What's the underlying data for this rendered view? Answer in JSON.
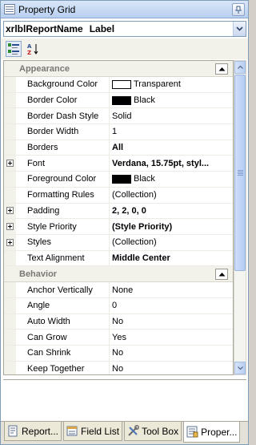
{
  "window": {
    "title": "Property Grid",
    "pin_icon": "pin-icon"
  },
  "selector": {
    "object_name": "xrlblReportName",
    "object_type": "Label"
  },
  "toolbar": {
    "categorized_icon": "categorized-icon",
    "alphabetical_icon": "alphabetical-icon"
  },
  "grid": {
    "categories": [
      {
        "label": "Appearance",
        "properties": [
          {
            "name": "Background Color",
            "value": "Transparent",
            "swatch": "#ffffff",
            "expandable": false,
            "bold": false
          },
          {
            "name": "Border Color",
            "value": "Black",
            "swatch": "#000000",
            "expandable": false,
            "bold": false
          },
          {
            "name": "Border Dash Style",
            "value": "Solid",
            "expandable": false,
            "bold": false
          },
          {
            "name": "Border Width",
            "value": "1",
            "expandable": false,
            "bold": false
          },
          {
            "name": "Borders",
            "value": "All",
            "expandable": false,
            "bold": true
          },
          {
            "name": "Font",
            "value": "Verdana, 15.75pt, styl...",
            "expandable": true,
            "bold": true
          },
          {
            "name": "Foreground Color",
            "value": "Black",
            "swatch": "#000000",
            "expandable": false,
            "bold": false
          },
          {
            "name": "Formatting Rules",
            "value": "(Collection)",
            "expandable": false,
            "bold": false
          },
          {
            "name": "Padding",
            "value": "2, 2, 0, 0",
            "expandable": true,
            "bold": true
          },
          {
            "name": "Style Priority",
            "value": "(Style Priority)",
            "expandable": true,
            "bold": true
          },
          {
            "name": "Styles",
            "value": "(Collection)",
            "expandable": true,
            "bold": false
          },
          {
            "name": "Text Alignment",
            "value": "Middle Center",
            "expandable": false,
            "bold": true
          }
        ]
      },
      {
        "label": "Behavior",
        "properties": [
          {
            "name": "Anchor Vertically",
            "value": "None",
            "expandable": false,
            "bold": false
          },
          {
            "name": "Angle",
            "value": "0",
            "expandable": false,
            "bold": false
          },
          {
            "name": "Auto Width",
            "value": "No",
            "expandable": false,
            "bold": false
          },
          {
            "name": "Can Grow",
            "value": "Yes",
            "expandable": false,
            "bold": false
          },
          {
            "name": "Can Shrink",
            "value": "No",
            "expandable": false,
            "bold": false
          },
          {
            "name": "Keep Together",
            "value": "No",
            "expandable": false,
            "bold": false
          }
        ]
      }
    ]
  },
  "tabs": [
    {
      "label": "Report...",
      "icon": "report-explorer-icon",
      "active": false
    },
    {
      "label": "Field List",
      "icon": "field-list-icon",
      "active": false
    },
    {
      "label": "Tool Box",
      "icon": "toolbox-icon",
      "active": false
    },
    {
      "label": "Proper...",
      "icon": "property-grid-icon",
      "active": true
    }
  ],
  "colors": {
    "title_gradient_top": "#d8e6f8",
    "title_gradient_bottom": "#b8cff0",
    "category_text": "#7a7a74",
    "gutter": "#f2f1ea"
  }
}
